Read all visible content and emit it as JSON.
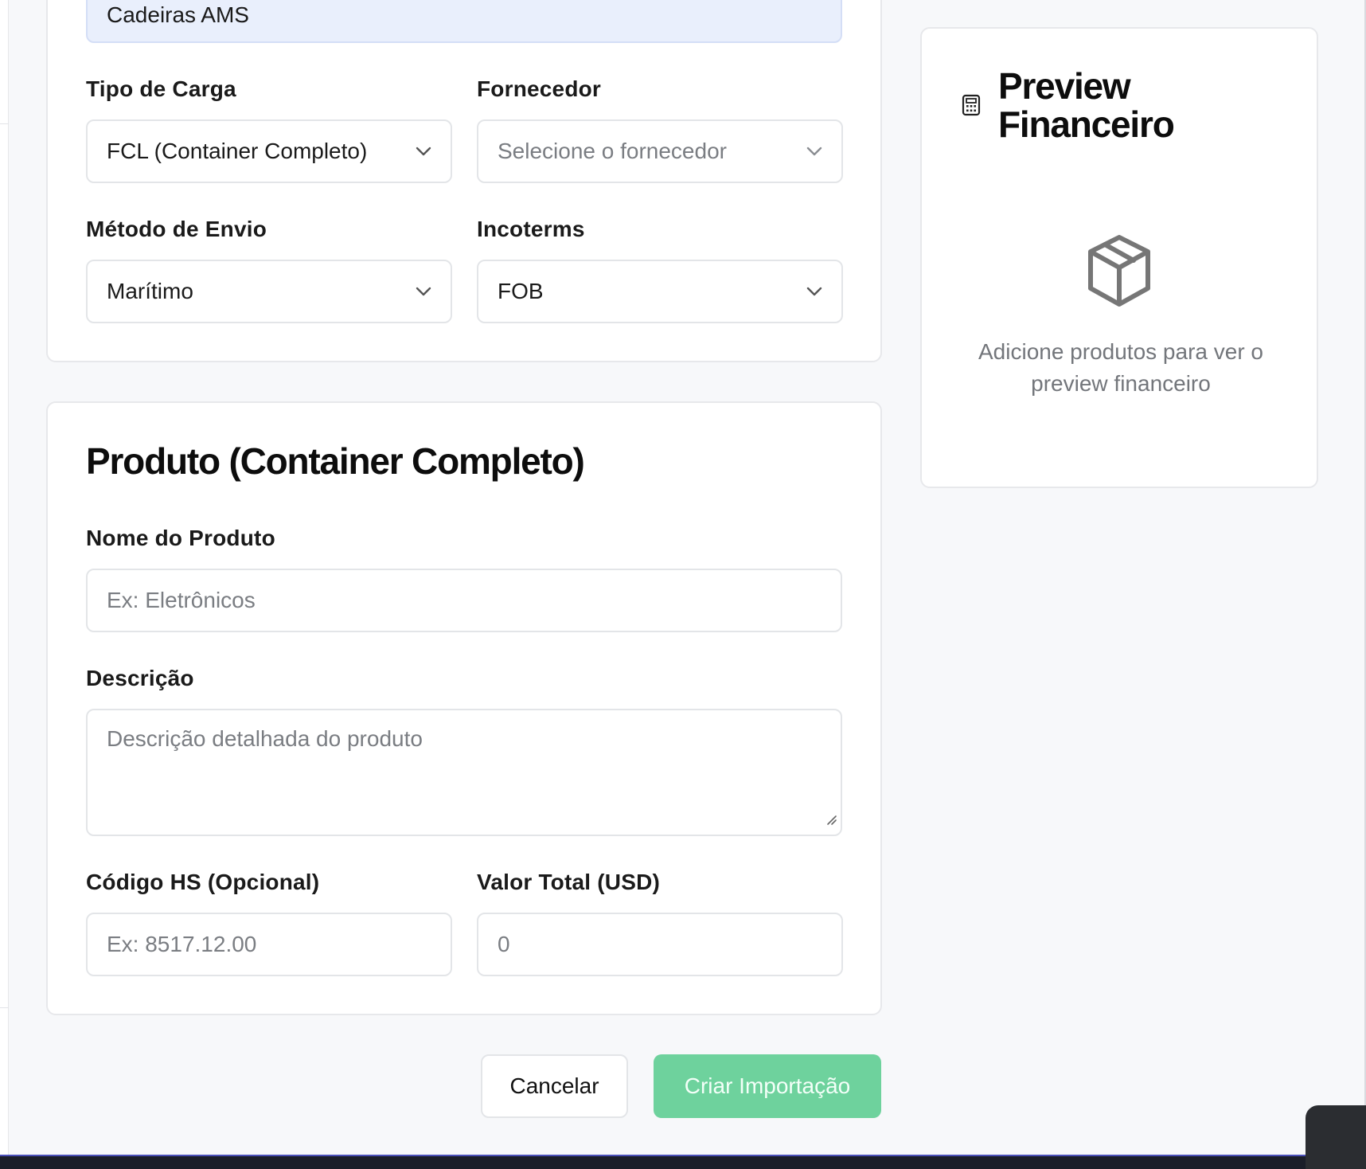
{
  "shipment": {
    "name_value": "Cadeiras AMS",
    "cargo_type": {
      "label": "Tipo de Carga",
      "value": "FCL (Container Completo)"
    },
    "supplier": {
      "label": "Fornecedor",
      "placeholder": "Selecione o fornecedor"
    },
    "shipping_method": {
      "label": "Método de Envio",
      "value": "Marítimo"
    },
    "incoterms": {
      "label": "Incoterms",
      "value": "FOB"
    }
  },
  "product": {
    "title": "Produto (Container Completo)",
    "name": {
      "label": "Nome do Produto",
      "placeholder": "Ex: Eletrônicos"
    },
    "description": {
      "label": "Descrição",
      "placeholder": "Descrição detalhada do produto"
    },
    "hs_code": {
      "label": "Código HS (Opcional)",
      "placeholder": "Ex: 8517.12.00"
    },
    "total_value": {
      "label": "Valor Total (USD)",
      "value": "0"
    }
  },
  "preview": {
    "title": "Preview Financeiro",
    "empty_text": "Adicione produtos para ver o preview financeiro",
    "icon": "calculator-icon",
    "empty_icon": "package-icon"
  },
  "actions": {
    "cancel_label": "Cancelar",
    "create_label": "Criar Importação"
  },
  "colors": {
    "primary_button": "#6ed29d",
    "highlight_field": "#e9effc",
    "background": "#f7f8fa"
  }
}
